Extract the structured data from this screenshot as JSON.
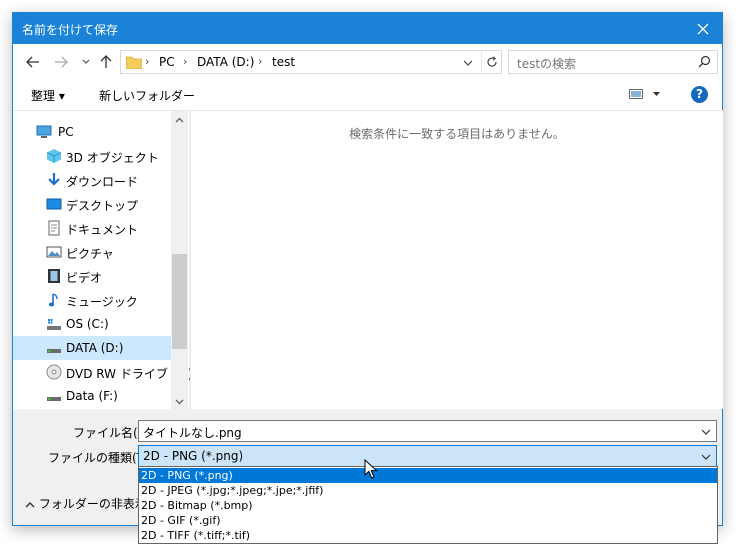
{
  "window": {
    "title": "名前を付けて保存"
  },
  "address": {
    "crumbs": [
      "PC",
      "DATA (D:)",
      "test"
    ]
  },
  "search": {
    "placeholder": "testの検索"
  },
  "toolbar": {
    "organize_label": "整理 ▾",
    "new_folder_label": "新しいフォルダー",
    "help_label": "?"
  },
  "navpane": {
    "items": [
      {
        "label": "PC",
        "icon": "pc-icon"
      },
      {
        "label": "3D オブジェクト",
        "icon": "cube-icon"
      },
      {
        "label": "ダウンロード",
        "icon": "download-icon"
      },
      {
        "label": "デスクトップ",
        "icon": "desktop-icon"
      },
      {
        "label": "ドキュメント",
        "icon": "document-icon"
      },
      {
        "label": "ピクチャ",
        "icon": "picture-icon"
      },
      {
        "label": "ビデオ",
        "icon": "video-icon"
      },
      {
        "label": "ミュージック",
        "icon": "music-icon"
      },
      {
        "label": "OS (C:)",
        "icon": "drive-os-icon"
      },
      {
        "label": "DATA (D:)",
        "icon": "drive-icon",
        "selected": true
      },
      {
        "label": "DVD RW ドライブ (E:)",
        "icon": "dvd-icon"
      },
      {
        "label": "Data (F:)",
        "icon": "drive-icon"
      }
    ]
  },
  "content": {
    "empty_message": "検索条件に一致する項目はありません。"
  },
  "form": {
    "filename_label": "ファイル名(N):",
    "filename_value": "タイトルなし.png",
    "filetype_label": "ファイルの種類(T):",
    "filetype_value": "2D - PNG (*.png)",
    "hide_folders_label": "フォルダーの非表示"
  },
  "filetype_options": [
    "2D - PNG (*.png)",
    "2D - JPEG (*.jpg;*.jpeg;*.jpe;*.jfif)",
    "2D - Bitmap (*.bmp)",
    "2D - GIF (*.gif)",
    "2D - TIFF (*.tiff;*.tif)"
  ],
  "colors": {
    "accent": "#0078d7",
    "titlebar": "#1a83d8",
    "selection": "#cce8ff"
  }
}
